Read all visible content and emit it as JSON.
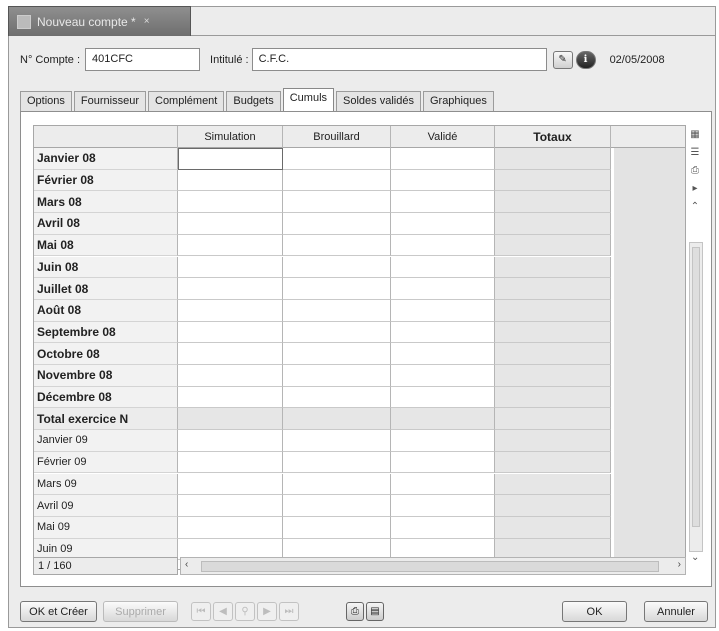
{
  "window": {
    "title": "Nouveau compte *",
    "close_glyph": "×"
  },
  "form": {
    "compte_label": "N° Compte :",
    "compte_value": "401CFC",
    "intitule_label": "Intitulé :",
    "intitule_value": "C.F.C.",
    "date": "02/05/2008"
  },
  "tabs": [
    {
      "label": "Options",
      "active": false
    },
    {
      "label": "Fournisseur",
      "active": false
    },
    {
      "label": "Complément",
      "active": false
    },
    {
      "label": "Budgets",
      "active": false
    },
    {
      "label": "Cumuls",
      "active": true
    },
    {
      "label": "Soldes validés",
      "active": false
    },
    {
      "label": "Graphiques",
      "active": false
    }
  ],
  "grid": {
    "columns": [
      "Simulation",
      "Brouillard",
      "Validé",
      "Totaux"
    ],
    "rows": [
      {
        "label": "Janvier 08",
        "bold": true
      },
      {
        "label": "Février 08",
        "bold": true
      },
      {
        "label": "Mars 08",
        "bold": true
      },
      {
        "label": "Avril 08",
        "bold": true
      },
      {
        "label": "Mai 08",
        "bold": true
      },
      {
        "label": "Juin 08",
        "bold": true
      },
      {
        "label": "Juillet 08",
        "bold": true
      },
      {
        "label": "Août 08",
        "bold": true
      },
      {
        "label": "Septembre 08",
        "bold": true
      },
      {
        "label": "Octobre 08",
        "bold": true
      },
      {
        "label": "Novembre 08",
        "bold": true
      },
      {
        "label": "Décembre 08",
        "bold": true
      },
      {
        "label": "Total exercice N",
        "bold": true,
        "total": true
      },
      {
        "label": "Janvier 09",
        "bold": false
      },
      {
        "label": "Février 09",
        "bold": false
      },
      {
        "label": "Mars 09",
        "bold": false
      },
      {
        "label": "Avril 09",
        "bold": false
      },
      {
        "label": "Mai 09",
        "bold": false
      },
      {
        "label": "Juin 09",
        "bold": false
      }
    ],
    "pager": "1 / 160"
  },
  "buttons": {
    "ok_creer": "OK et Créer",
    "supprimer": "Supprimer",
    "ok": "OK",
    "annuler": "Annuler"
  },
  "icons": {
    "info": "ℹ",
    "note": "✎",
    "print": "⎙",
    "preview": "▤"
  }
}
